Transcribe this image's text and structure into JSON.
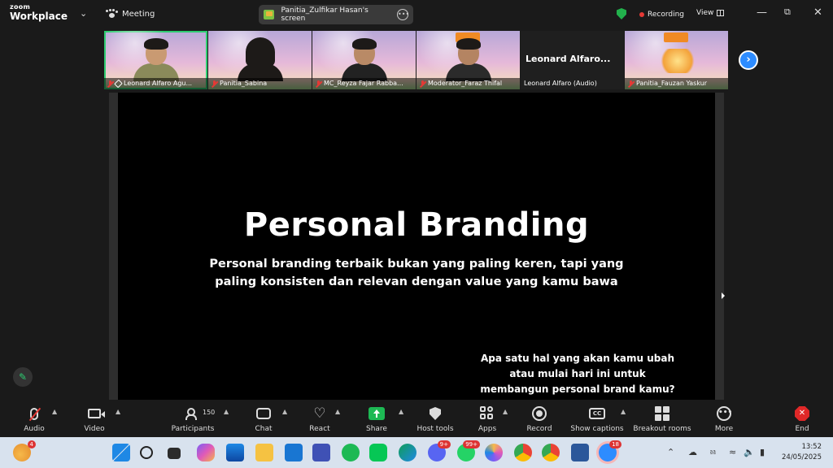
{
  "app": {
    "logo_line1": "zoom",
    "logo_line2": "Workplace",
    "meeting_label": "Meeting",
    "sharing_label": "Panitia_Zulfikar Hasan's screen",
    "recording_label": "Recording",
    "view_label": "View"
  },
  "thumbnails": [
    {
      "name": "Leonard Alfaro Agu...",
      "muted": true,
      "pinned": true,
      "active": true
    },
    {
      "name": "Panitia_Sabina",
      "muted": true
    },
    {
      "name": "MC_Reyza Fajar Rabba...",
      "muted": true
    },
    {
      "name": "Moderator_Faraz Thifal",
      "muted": true
    },
    {
      "name": "Leonard Alfaro (Audio)",
      "display": "Leonard  Alfaro...",
      "muted": false
    },
    {
      "name": "Panitia_Fauzan Yaskur",
      "muted": true
    }
  ],
  "slide": {
    "title": "Personal Branding",
    "subtitle_line1": "Personal branding terbaik bukan yang paling keren, tapi yang",
    "subtitle_line2": "paling konsisten dan relevan dengan value yang kamu bawa",
    "question_line1": "Apa satu hal yang akan kamu ubah",
    "question_line2": "atau mulai hari ini untuk",
    "question_line3": "membangun personal brand kamu?"
  },
  "toolbar": {
    "audio": "Audio",
    "video": "Video",
    "participants": "Participants",
    "participants_count": "150",
    "chat": "Chat",
    "react": "React",
    "share": "Share",
    "host_tools": "Host tools",
    "apps": "Apps",
    "record": "Record",
    "captions": "Show captions",
    "captions_icon": "CC",
    "breakout": "Breakout rooms",
    "more": "More",
    "end": "End"
  },
  "taskbar": {
    "weather_badge": "4",
    "discord_badge": "9+",
    "whatsapp_badge": "99+",
    "zoom_badge": "18",
    "time": "13:52",
    "date": "24/05/2025"
  },
  "colors": {
    "accent": "#2d8cff",
    "active_border": "#2ecc71",
    "muted_red": "#e53935",
    "share_green": "#1db954",
    "end_red": "#e02828"
  }
}
